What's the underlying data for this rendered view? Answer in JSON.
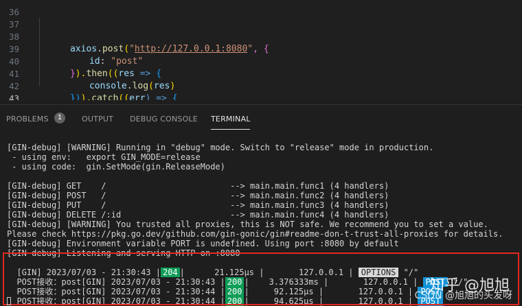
{
  "editor": {
    "lines": [
      {
        "n": "36"
      },
      {
        "n": "37",
        "t": [
          "axios",
          ".",
          "post",
          "(",
          "\"",
          "http://127.0.0.1:8080",
          "\"",
          ", {"
        ]
      },
      {
        "n": "38",
        "t": [
          "id",
          ": ",
          "\"post\""
        ]
      },
      {
        "n": "39",
        "t": [
          "}",
          ").",
          "then",
          "((",
          "res",
          " => ",
          "{"
        ]
      },
      {
        "n": "40",
        "t": [
          "console",
          ".",
          "log",
          "(",
          "res",
          ")"
        ]
      },
      {
        "n": "41",
        "t": [
          "})",
          ").",
          "catch",
          "((",
          "err",
          ") => ",
          "{"
        ]
      },
      {
        "n": "42",
        "t": [
          "console",
          ".",
          "log",
          "(",
          "err",
          ")"
        ]
      },
      {
        "n": "43",
        "t": [
          "})"
        ]
      }
    ]
  },
  "panel": {
    "tabs": {
      "problems": "PROBLEMS",
      "problems_count": "1",
      "output": "OUTPUT",
      "debug": "DEBUG CONSOLE",
      "terminal": "TERMINAL"
    }
  },
  "terminal": {
    "lines": [
      "[GIN-debug] [WARNING] Running in \"debug\" mode. Switch to \"release\" mode in production.",
      " - using env:   export GIN_MODE=release",
      " - using code:  gin.SetMode(gin.ReleaseMode)",
      "",
      "[GIN-debug] GET    /                         --> main.main.func1 (4 handlers)",
      "[GIN-debug] POST   /                         --> main.main.func2 (4 handlers)",
      "[GIN-debug] PUT    /                         --> main.main.func3 (4 handlers)",
      "[GIN-debug] DELETE /:id                      --> main.main.func4 (4 handlers)",
      "[GIN-debug] [WARNING] You trusted all proxies, this is NOT safe. We recommend you to set a value.",
      "Please check https://pkg.go.dev/github.com/gin-gonic/gin#readme-don-t-trust-all-proxies for details.",
      "[GIN-debug] Environment variable PORT is undefined. Using port :8080 by default",
      "[GIN-debug] Listening and serving HTTP on :8080"
    ],
    "logs": [
      {
        "prefix": "[GIN] 2023/07/03 - 21:30:43 |",
        "status": "204",
        "mid": "|      21.125µs |       127.0.0.1 |",
        "method": "OPTIONS",
        "method_kind": "options",
        "path": "\"/\""
      },
      {
        "prefix": "POST接收：post[GIN] 2023/07/03 - 21:30:43 |",
        "status": "200",
        "mid": "|    3.376333ms |       127.0.0.1 |",
        "method": "POST",
        "method_kind": "post",
        "path": "\"/\""
      },
      {
        "prefix": "POST接收：post[GIN] 2023/07/03 - 21:30:44 |",
        "status": "200",
        "mid": "|     92.125µs |       127.0.0.1 |",
        "method": "POST",
        "method_kind": "post",
        "path": ""
      },
      {
        "prefix": "POST接收：post[GIN] 2023/07/03 - 21:30:44 |",
        "status": "200",
        "mid": "|     94.625µs |       127.0.0.1 |",
        "method": "POST",
        "method_kind": "post",
        "path": ""
      }
    ]
  },
  "watermark": {
    "main": "知乎 @旭旭",
    "sub": "CSDN @旭旭的头发呀"
  },
  "colors": {
    "status_ok": "#0f9d58",
    "method_post": "#1493d6",
    "method_options": "#d9d9d9",
    "highlight_border": "#e2291f"
  }
}
